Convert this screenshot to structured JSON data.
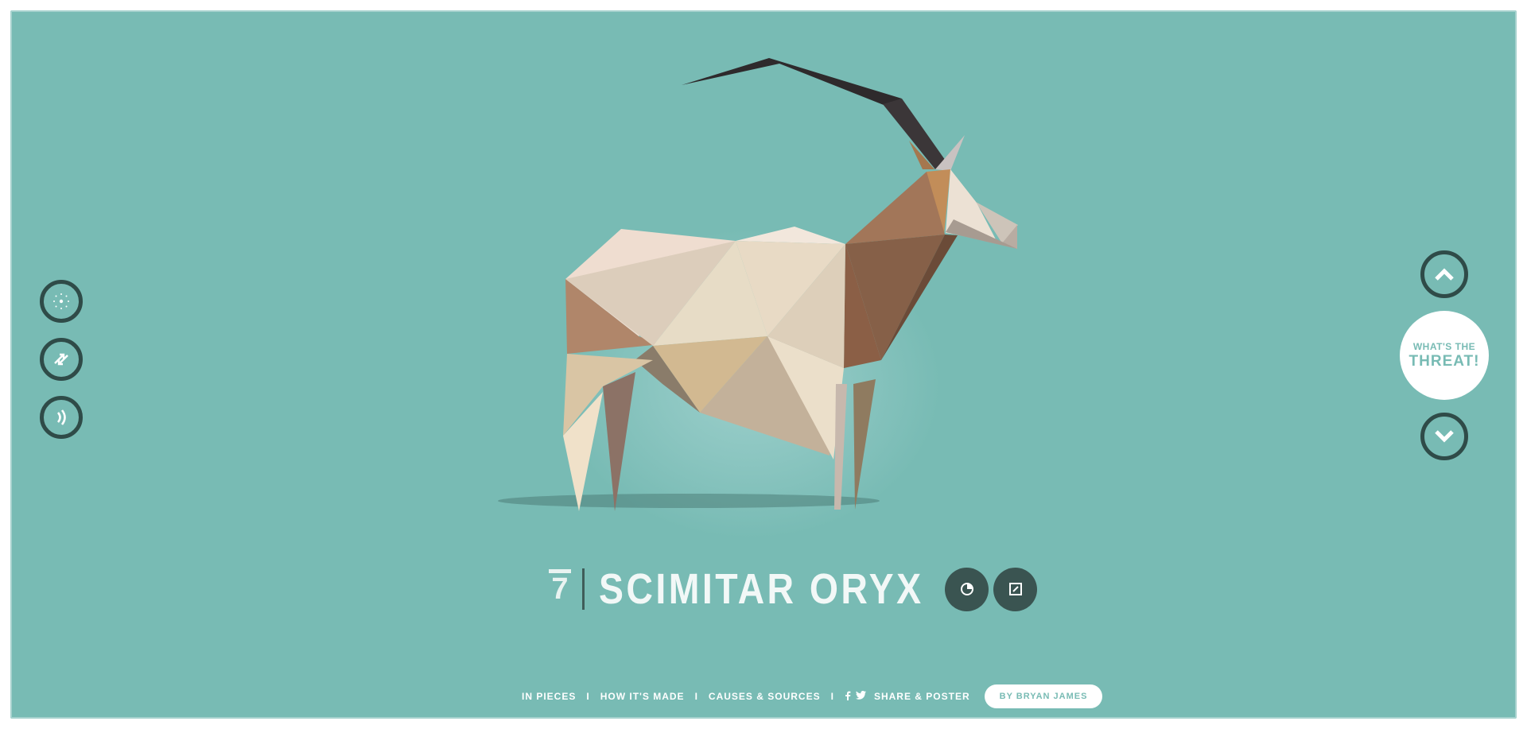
{
  "species": {
    "rank": "7",
    "name": "SCIMITAR ORYX"
  },
  "threat_button": {
    "line1": "WHAT'S THE",
    "line2": "THREAT!"
  },
  "footer": {
    "links": [
      "IN PIECES",
      "HOW IT'S MADE",
      "CAUSES & SOURCES",
      "SHARE & POSTER"
    ],
    "separator": "I",
    "author": "BY BRYAN JAMES"
  },
  "icons": {
    "left_controls": [
      "dots-icon",
      "shuffle-icon",
      "sound-icon"
    ],
    "right_controls": [
      "chevron-up-icon",
      "chevron-down-icon"
    ],
    "title_controls": [
      "pie-chart-icon",
      "expand-icon"
    ],
    "social": [
      "facebook-icon",
      "twitter-icon"
    ]
  },
  "colors": {
    "background": "#78bbb4",
    "control_dark": "#2f4b48",
    "text_light": "#f2f8f7"
  }
}
